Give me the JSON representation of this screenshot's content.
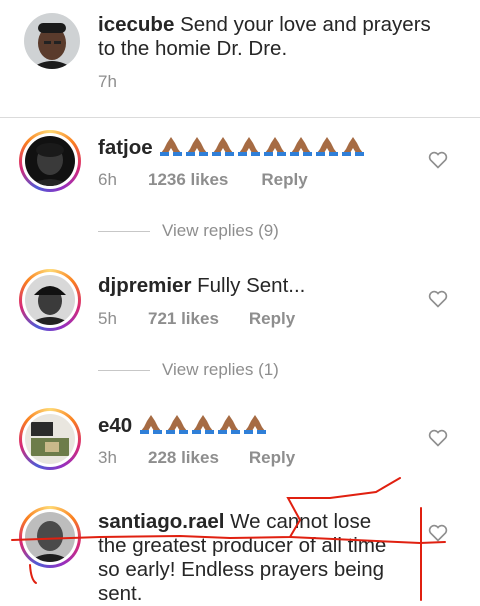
{
  "caption": {
    "username": "icecube",
    "text": "Send your love and prayers to the homie Dr. Dre.",
    "time": "7h"
  },
  "comments": [
    {
      "username": "fatjoe",
      "text": "",
      "emoji_count": 8,
      "emoji": "folded-hands",
      "time": "6h",
      "likes": "1236 likes",
      "reply": "Reply",
      "view_replies": "View replies (9)"
    },
    {
      "username": "djpremier",
      "text": "Fully Sent...",
      "time": "5h",
      "likes": "721 likes",
      "reply": "Reply",
      "view_replies": "View replies (1)"
    },
    {
      "username": "e40",
      "text": "",
      "emoji_count": 5,
      "emoji": "folded-hands",
      "time": "3h",
      "likes": "228 likes",
      "reply": "Reply"
    },
    {
      "username": "santiago.rael",
      "text_line1": "We cannot lose",
      "text_line2": "the greatest producer of all time",
      "text_line3": "so early! Endless prayers being",
      "text_line4": "sent."
    }
  ],
  "colors": {
    "annotation_red": "#e02010",
    "muted": "#8e8e8e",
    "text": "#262626"
  }
}
